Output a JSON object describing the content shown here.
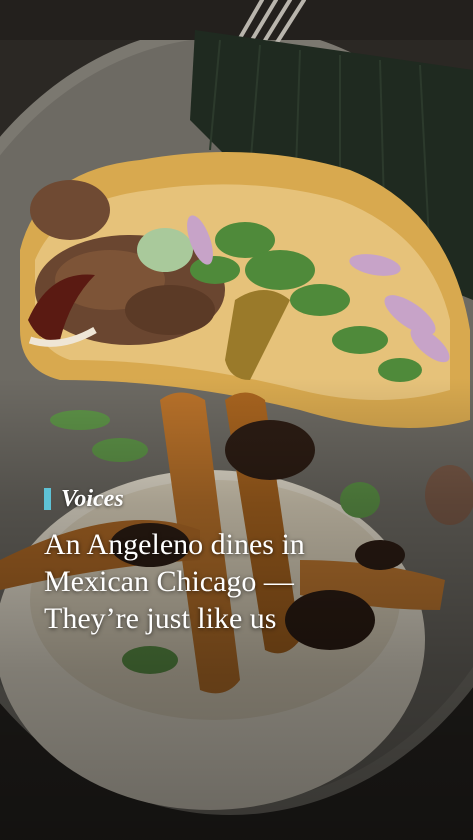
{
  "story": {
    "kicker": "Voices",
    "headline_lines": [
      "An Angeleno dines in",
      "Mexican Chicago —",
      "They’re just like us"
    ],
    "accent_color": "#5ec2d6"
  },
  "image": {
    "subject": "tacos-on-plate-photo"
  }
}
